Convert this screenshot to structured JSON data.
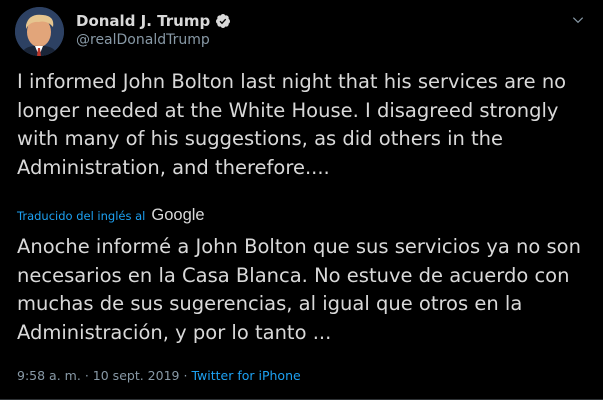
{
  "author": {
    "name": "Donald J. Trump",
    "handle": "@realDonaldTrump",
    "verified": true,
    "avatar_icon": "profile-photo"
  },
  "tweet": {
    "text": "I informed John Bolton last night that his services are no longer needed at the White House. I disagreed strongly with many of his suggestions, as did others in the Administration, and therefore....",
    "translation_label": "Traducido del inglés al",
    "translation_provider": "Google",
    "translated_text": "Anoche informé a John Bolton que sus servicios ya no son necesarios en la Casa Blanca. No estuve de acuerdo con muchas de sus sugerencias, al igual que otros en la Administración, y por lo tanto ...",
    "time": "9:58 a. m.",
    "separator": "·",
    "date": "10 sept. 2019",
    "source": "Twitter for iPhone"
  },
  "colors": {
    "background": "#000000",
    "text": "#d9d9d9",
    "secondary": "#8899a6",
    "accent": "#1da1f2"
  }
}
